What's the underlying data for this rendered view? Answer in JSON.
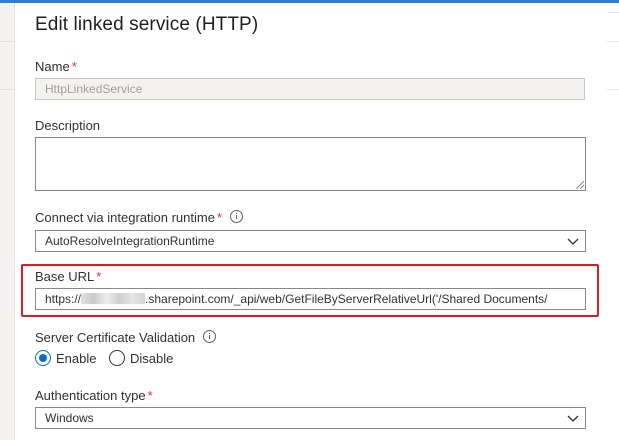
{
  "panel": {
    "title": "Edit linked service (HTTP)"
  },
  "fields": {
    "name": {
      "label": "Name",
      "required_mark": "*",
      "placeholder": "HttpLinkedService"
    },
    "description": {
      "label": "Description",
      "value": ""
    },
    "integration_runtime": {
      "label": "Connect via integration runtime",
      "required_mark": "*",
      "info_icon": "info-icon",
      "value": "AutoResolveIntegrationRuntime"
    },
    "base_url": {
      "label": "Base URL",
      "required_mark": "*",
      "value_prefix": "https://",
      "value_suffix": ".sharepoint.com/_api/web/GetFileByServerRelativeUrl('/Shared Documents/",
      "highlight_color": "#e01b24"
    },
    "cert_validation": {
      "label": "Server Certificate Validation",
      "info_icon": "info-icon",
      "options": [
        {
          "label": "Enable",
          "selected": true
        },
        {
          "label": "Disable",
          "selected": false
        }
      ]
    },
    "auth_type": {
      "label": "Authentication type",
      "required_mark": "*",
      "value": "Windows"
    }
  },
  "colors": {
    "accent": "#0f6cbd",
    "required": "#d13438",
    "top_bar": "#2f7fd6"
  }
}
